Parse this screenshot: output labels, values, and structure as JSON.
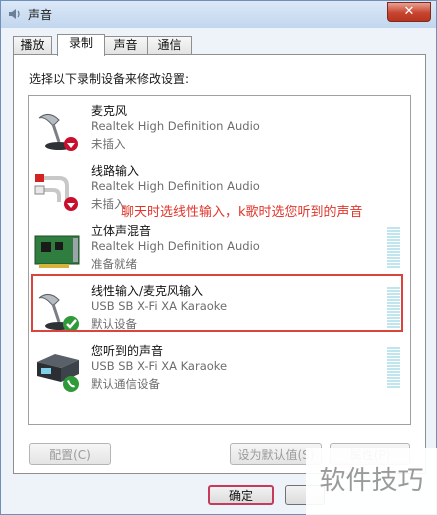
{
  "window": {
    "title": "声音",
    "close_glyph": "✕"
  },
  "tabs": [
    {
      "label": "播放",
      "active": false
    },
    {
      "label": "录制",
      "active": true
    },
    {
      "label": "声音",
      "active": false
    },
    {
      "label": "通信",
      "active": false
    }
  ],
  "prompt": "选择以下录制设备来修改设置:",
  "devices": [
    {
      "name": "麦克风",
      "driver": "Realtek High Definition Audio",
      "status": "未插入",
      "icon": "microphone-icon",
      "badge": "unplugged-badge-icon"
    },
    {
      "name": "线路输入",
      "driver": "Realtek High Definition Audio",
      "status": "未插入",
      "icon": "line-in-rca-icon",
      "badge": "unplugged-badge-icon"
    },
    {
      "name": "立体声混音",
      "driver": "Realtek High Definition Audio",
      "status": "准备就绪",
      "icon": "sound-card-icon",
      "badge": ""
    },
    {
      "name": "线性输入/麦克风输入",
      "driver": "USB SB X-Fi XA Karaoke",
      "status": "默认设备",
      "icon": "microphone-icon",
      "badge": "default-check-icon"
    },
    {
      "name": "您听到的声音",
      "driver": "USB SB X-Fi XA Karaoke",
      "status": "默认通信设备",
      "icon": "speaker-box-icon",
      "badge": "phone-badge-icon"
    }
  ],
  "annotation": "聊天时选线性输入，k歌时选您听到的声音",
  "buttons": {
    "configure": "配置(C)",
    "set_default": "设为默认值(S)",
    "properties": "属性(P)",
    "ok": "确定"
  },
  "watermark": "软件技巧",
  "colors": {
    "annotation": "#e0352b",
    "highlight_border": "#d9453c",
    "meter": "#bfe6ef"
  }
}
